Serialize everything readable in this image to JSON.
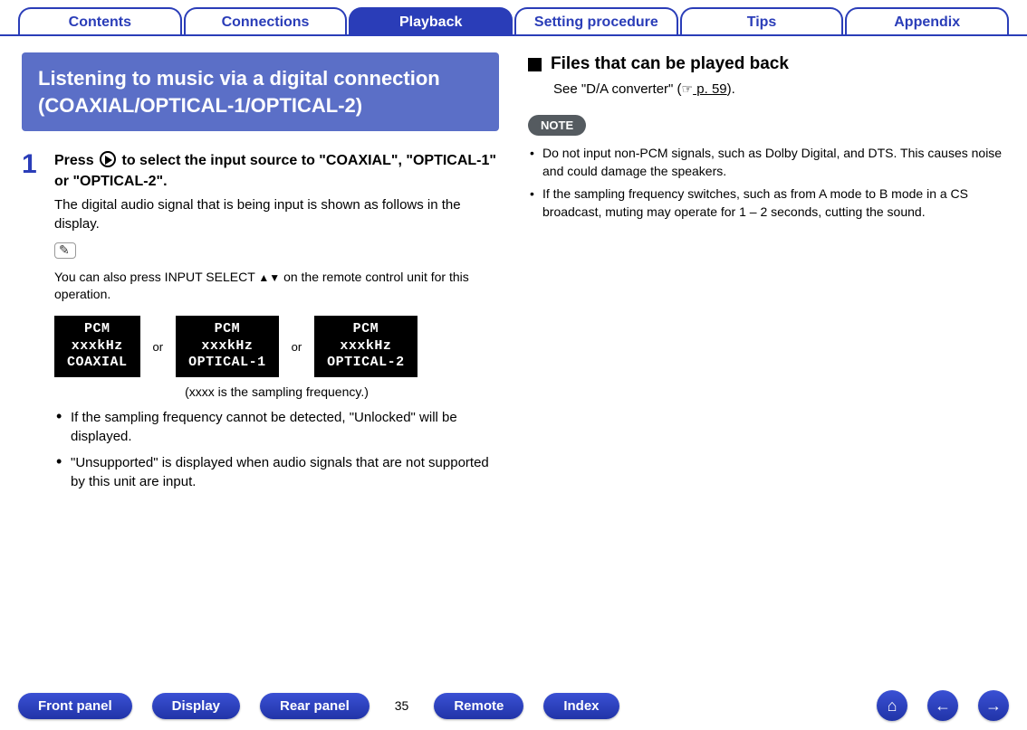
{
  "top_tabs": [
    "Contents",
    "Connections",
    "Playback",
    "Setting procedure",
    "Tips",
    "Appendix"
  ],
  "top_tabs_active_index": 2,
  "left": {
    "heading": "Listening to music via a digital connection (COAXIAL/OPTICAL-1/OPTICAL-2)",
    "step_number": "1",
    "step_title_before": "Press ",
    "step_title_after": " to select the input source to \"COAXIAL\", \"OPTICAL-1\" or \"OPTICAL-2\".",
    "step_desc": "The digital audio signal that is being input is shown as follows in the display.",
    "remote_note_before": "You can also press INPUT SELECT ",
    "remote_note_arrows": "▲▼",
    "remote_note_after": " on the remote control unit for this operation.",
    "displays": [
      "PCM\nxxxkHz\nCOAXIAL",
      "PCM\nxxxkHz\nOPTICAL-1",
      "PCM\nxxxkHz\nOPTICAL-2"
    ],
    "or_label": "or",
    "caption": "(xxxx is the sampling frequency.)",
    "bullets": [
      "If the sampling frequency cannot be detected, \"Unlocked\" will be displayed.",
      "\"Unsupported\" is displayed when audio signals that are not supported by this unit are input."
    ]
  },
  "right": {
    "heading": "Files that can be played back",
    "see_before": "See \"D/A converter\" (",
    "see_link": " p. 59",
    "see_after": ").",
    "note_label": "NOTE",
    "notes": [
      "Do not input non-PCM signals, such as Dolby Digital, and DTS. This causes noise and could damage the speakers.",
      "If the sampling frequency switches, such as from A mode to B mode in a CS broadcast, muting may operate for 1 – 2 seconds, cutting the sound."
    ]
  },
  "bottom": {
    "buttons": [
      "Front panel",
      "Display",
      "Rear panel",
      "Remote",
      "Index"
    ],
    "page": "35"
  },
  "nav_icons": {
    "home": "⌂",
    "prev": "←",
    "next": "→"
  }
}
